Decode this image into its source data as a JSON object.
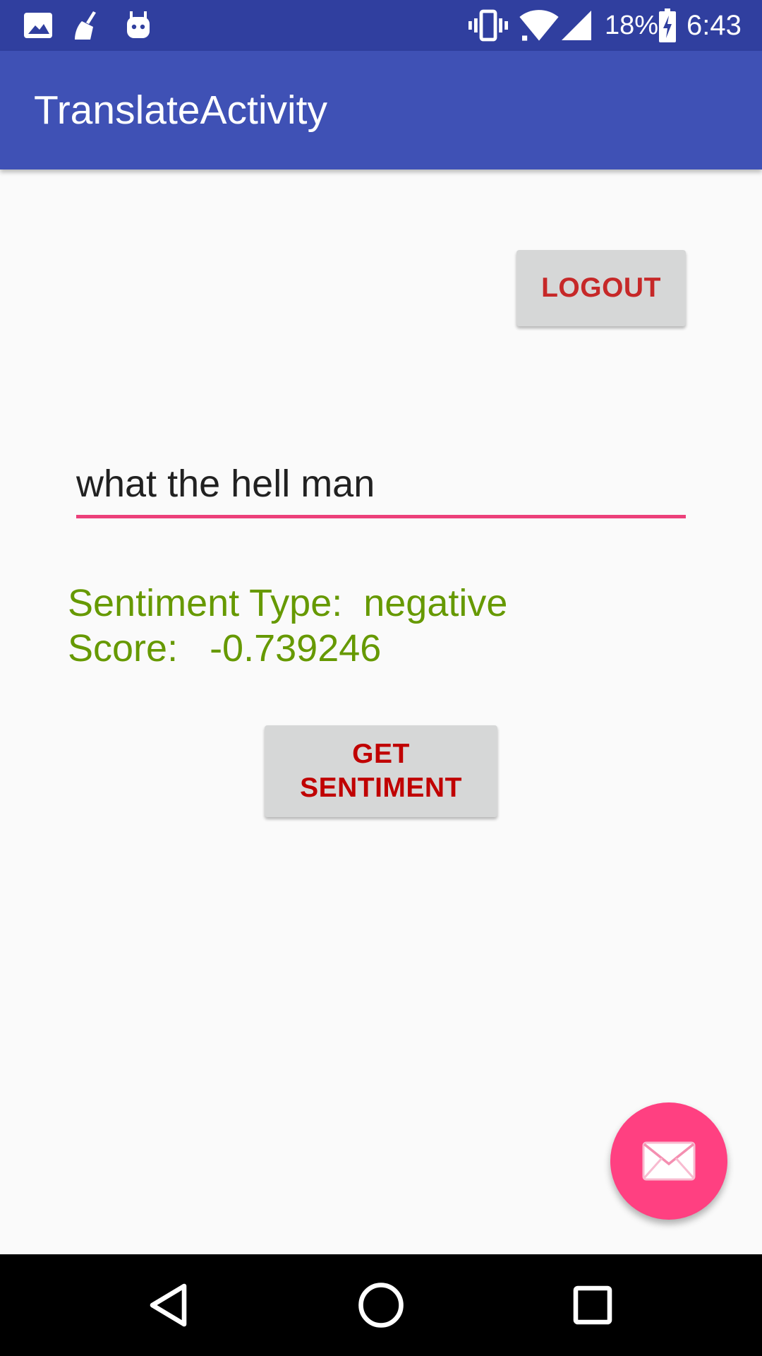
{
  "status_bar": {
    "battery_percent": "18%",
    "time": "6:43",
    "icons": [
      "image-icon",
      "broom-icon",
      "android-icon",
      "vibrate-icon",
      "wifi-icon",
      "signal-icon",
      "battery-charging-icon"
    ]
  },
  "app_bar": {
    "title": "TranslateActivity"
  },
  "logout_button": {
    "label": "LOGOUT"
  },
  "input": {
    "value": "what the hell man"
  },
  "result": {
    "sentiment_line": "Sentiment Type:  negative",
    "score_line": "Score:   -0.739246"
  },
  "sentiment_button": {
    "label": "GET\nSENTIMENT"
  },
  "fab": {
    "icon": "mail-icon"
  },
  "nav_bar": {
    "buttons": [
      "back-icon",
      "home-icon",
      "recents-icon"
    ]
  },
  "colors": {
    "status_bar": "#303f9f",
    "app_bar": "#3f51b5",
    "accent": "#ff4081",
    "result_text": "#669900",
    "button_text": "#c62828"
  }
}
